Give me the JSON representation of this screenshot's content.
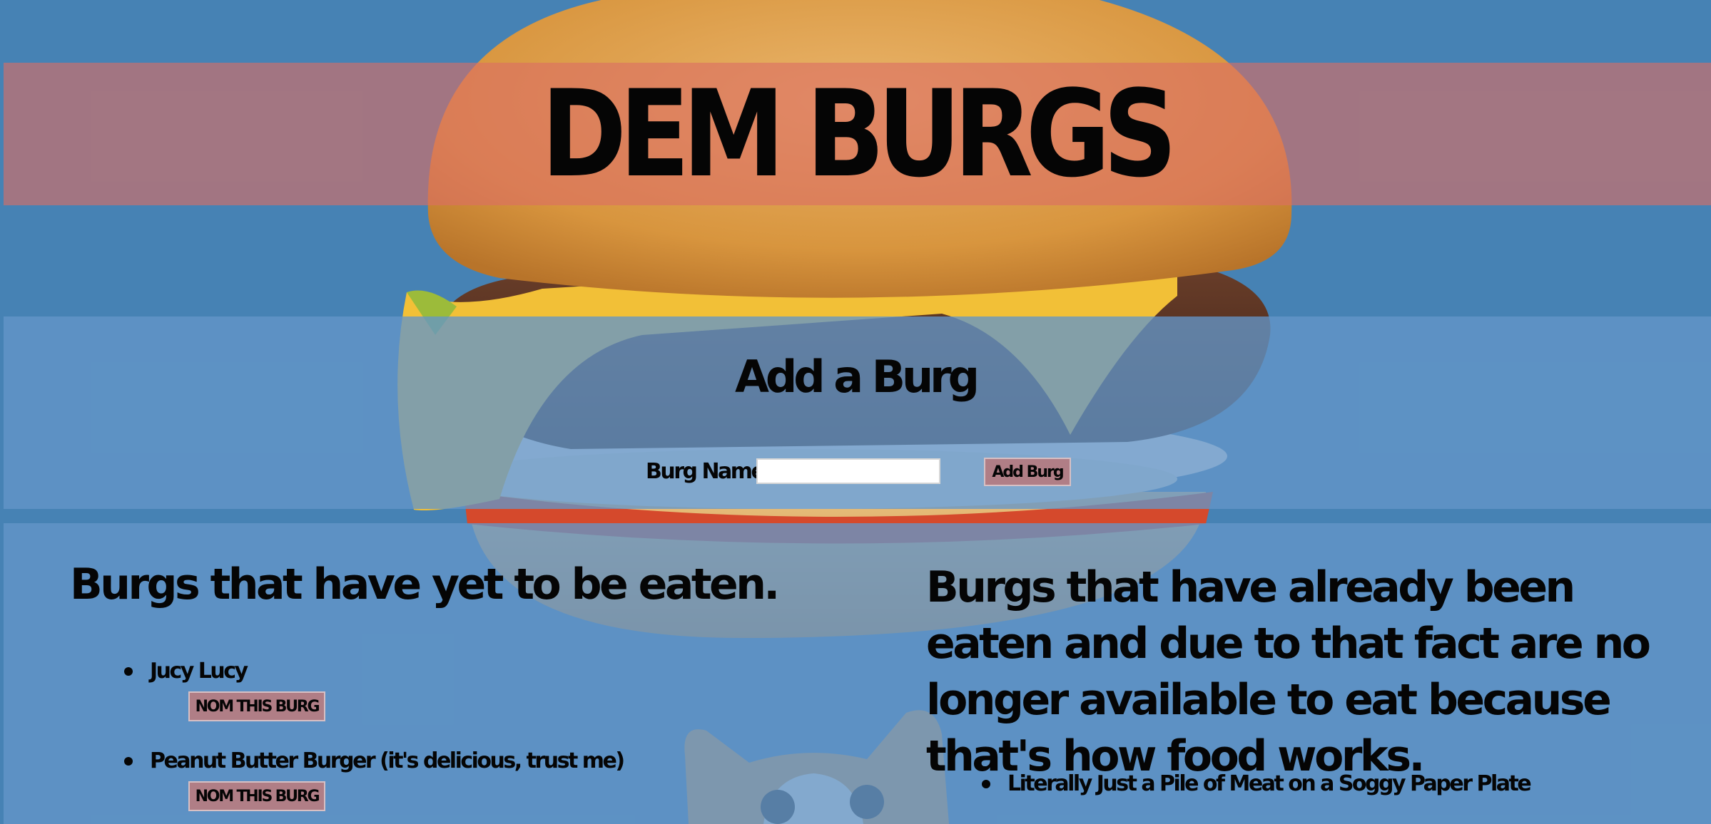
{
  "header": {
    "title": "DEM BURGS"
  },
  "add_form": {
    "heading": "Add a Burg",
    "name_label": "Burg Name:",
    "name_value": "",
    "submit_label": "Add Burg"
  },
  "uneaten": {
    "heading": "Burgs that have yet to be eaten.",
    "items": [
      {
        "name": "Jucy Lucy",
        "button_label": "NOM THIS BURG"
      },
      {
        "name": "Peanut Butter Burger (it's delicious, trust me)",
        "button_label": "NOM THIS BURG"
      }
    ]
  },
  "eaten": {
    "heading": "Burgs that have already been eaten and due to that fact are no longer available to eat because that's how food works.",
    "items": [
      {
        "name": "Literally Just a Pile of Meat on a Soggy Paper Plate"
      }
    ]
  },
  "colors": {
    "page_background": "#4682b4",
    "header_band": "#dc6e64",
    "panel": "#6496c8",
    "button": "#b07e86"
  },
  "background_images": [
    "cheeseburger-photo",
    "cat-photo"
  ]
}
